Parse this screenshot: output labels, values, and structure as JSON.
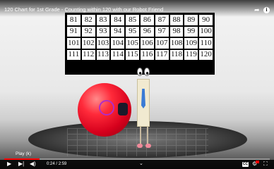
{
  "video": {
    "title": "120 Chart for 1st Grade - Counting within 120 with our Robot Friend",
    "status_label": "Play (k)",
    "time_current": "0:24",
    "time_total": "2:59",
    "time_separator": " / ",
    "progress": 0.134
  },
  "number_grid": [
    [
      "81",
      "82",
      "83",
      "84",
      "85",
      "86",
      "87",
      "88",
      "89",
      "90"
    ],
    [
      "91",
      "92",
      "93",
      "94",
      "95",
      "96",
      "97",
      "98",
      "99",
      "100"
    ],
    [
      "101",
      "102",
      "103",
      "104",
      "105",
      "106",
      "107",
      "108",
      "109",
      "110"
    ],
    [
      "111",
      "112",
      "113",
      "114",
      "115",
      "116",
      "117",
      "118",
      "119",
      "120"
    ]
  ],
  "controls": {
    "play_icon": "play-icon",
    "next_icon": "skip-next-icon",
    "volume_icon": "volume-icon",
    "captions_label": "CC",
    "captions_icon": "subtitles-icon",
    "settings_icon": "settings-gear-icon",
    "fullscreen_icon": "fullscreen-icon",
    "chevron_icon": "chevron-down-icon",
    "share_icon": "share-icon",
    "info_icon": "info-icon"
  },
  "colors": {
    "progress": "#ff0000",
    "hd_badge": "#ff0000"
  }
}
